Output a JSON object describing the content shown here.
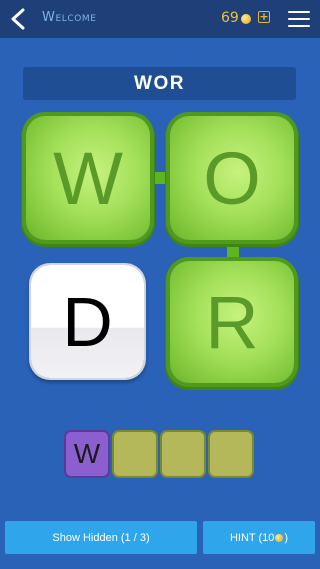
{
  "header": {
    "title": "Welcome",
    "coins": "69"
  },
  "game": {
    "current_word": "WOR",
    "tiles": [
      {
        "letter": "W",
        "state": "selected"
      },
      {
        "letter": "O",
        "state": "selected"
      },
      {
        "letter": "D",
        "state": "unselected"
      },
      {
        "letter": "R",
        "state": "selected"
      }
    ],
    "answer_slots": [
      {
        "letter": "W"
      },
      {
        "letter": ""
      },
      {
        "letter": ""
      },
      {
        "letter": ""
      }
    ]
  },
  "buttons": {
    "show_hidden": "Show Hidden (1 / 3)",
    "hint_prefix": "HINT (10",
    "hint_suffix": ")"
  },
  "colors": {
    "background": "#2a62b8",
    "topbar": "#1f3f78",
    "tile_green": "#a4e05a",
    "slot_filled": "#8c5fd0",
    "button": "#2fa6ec"
  }
}
